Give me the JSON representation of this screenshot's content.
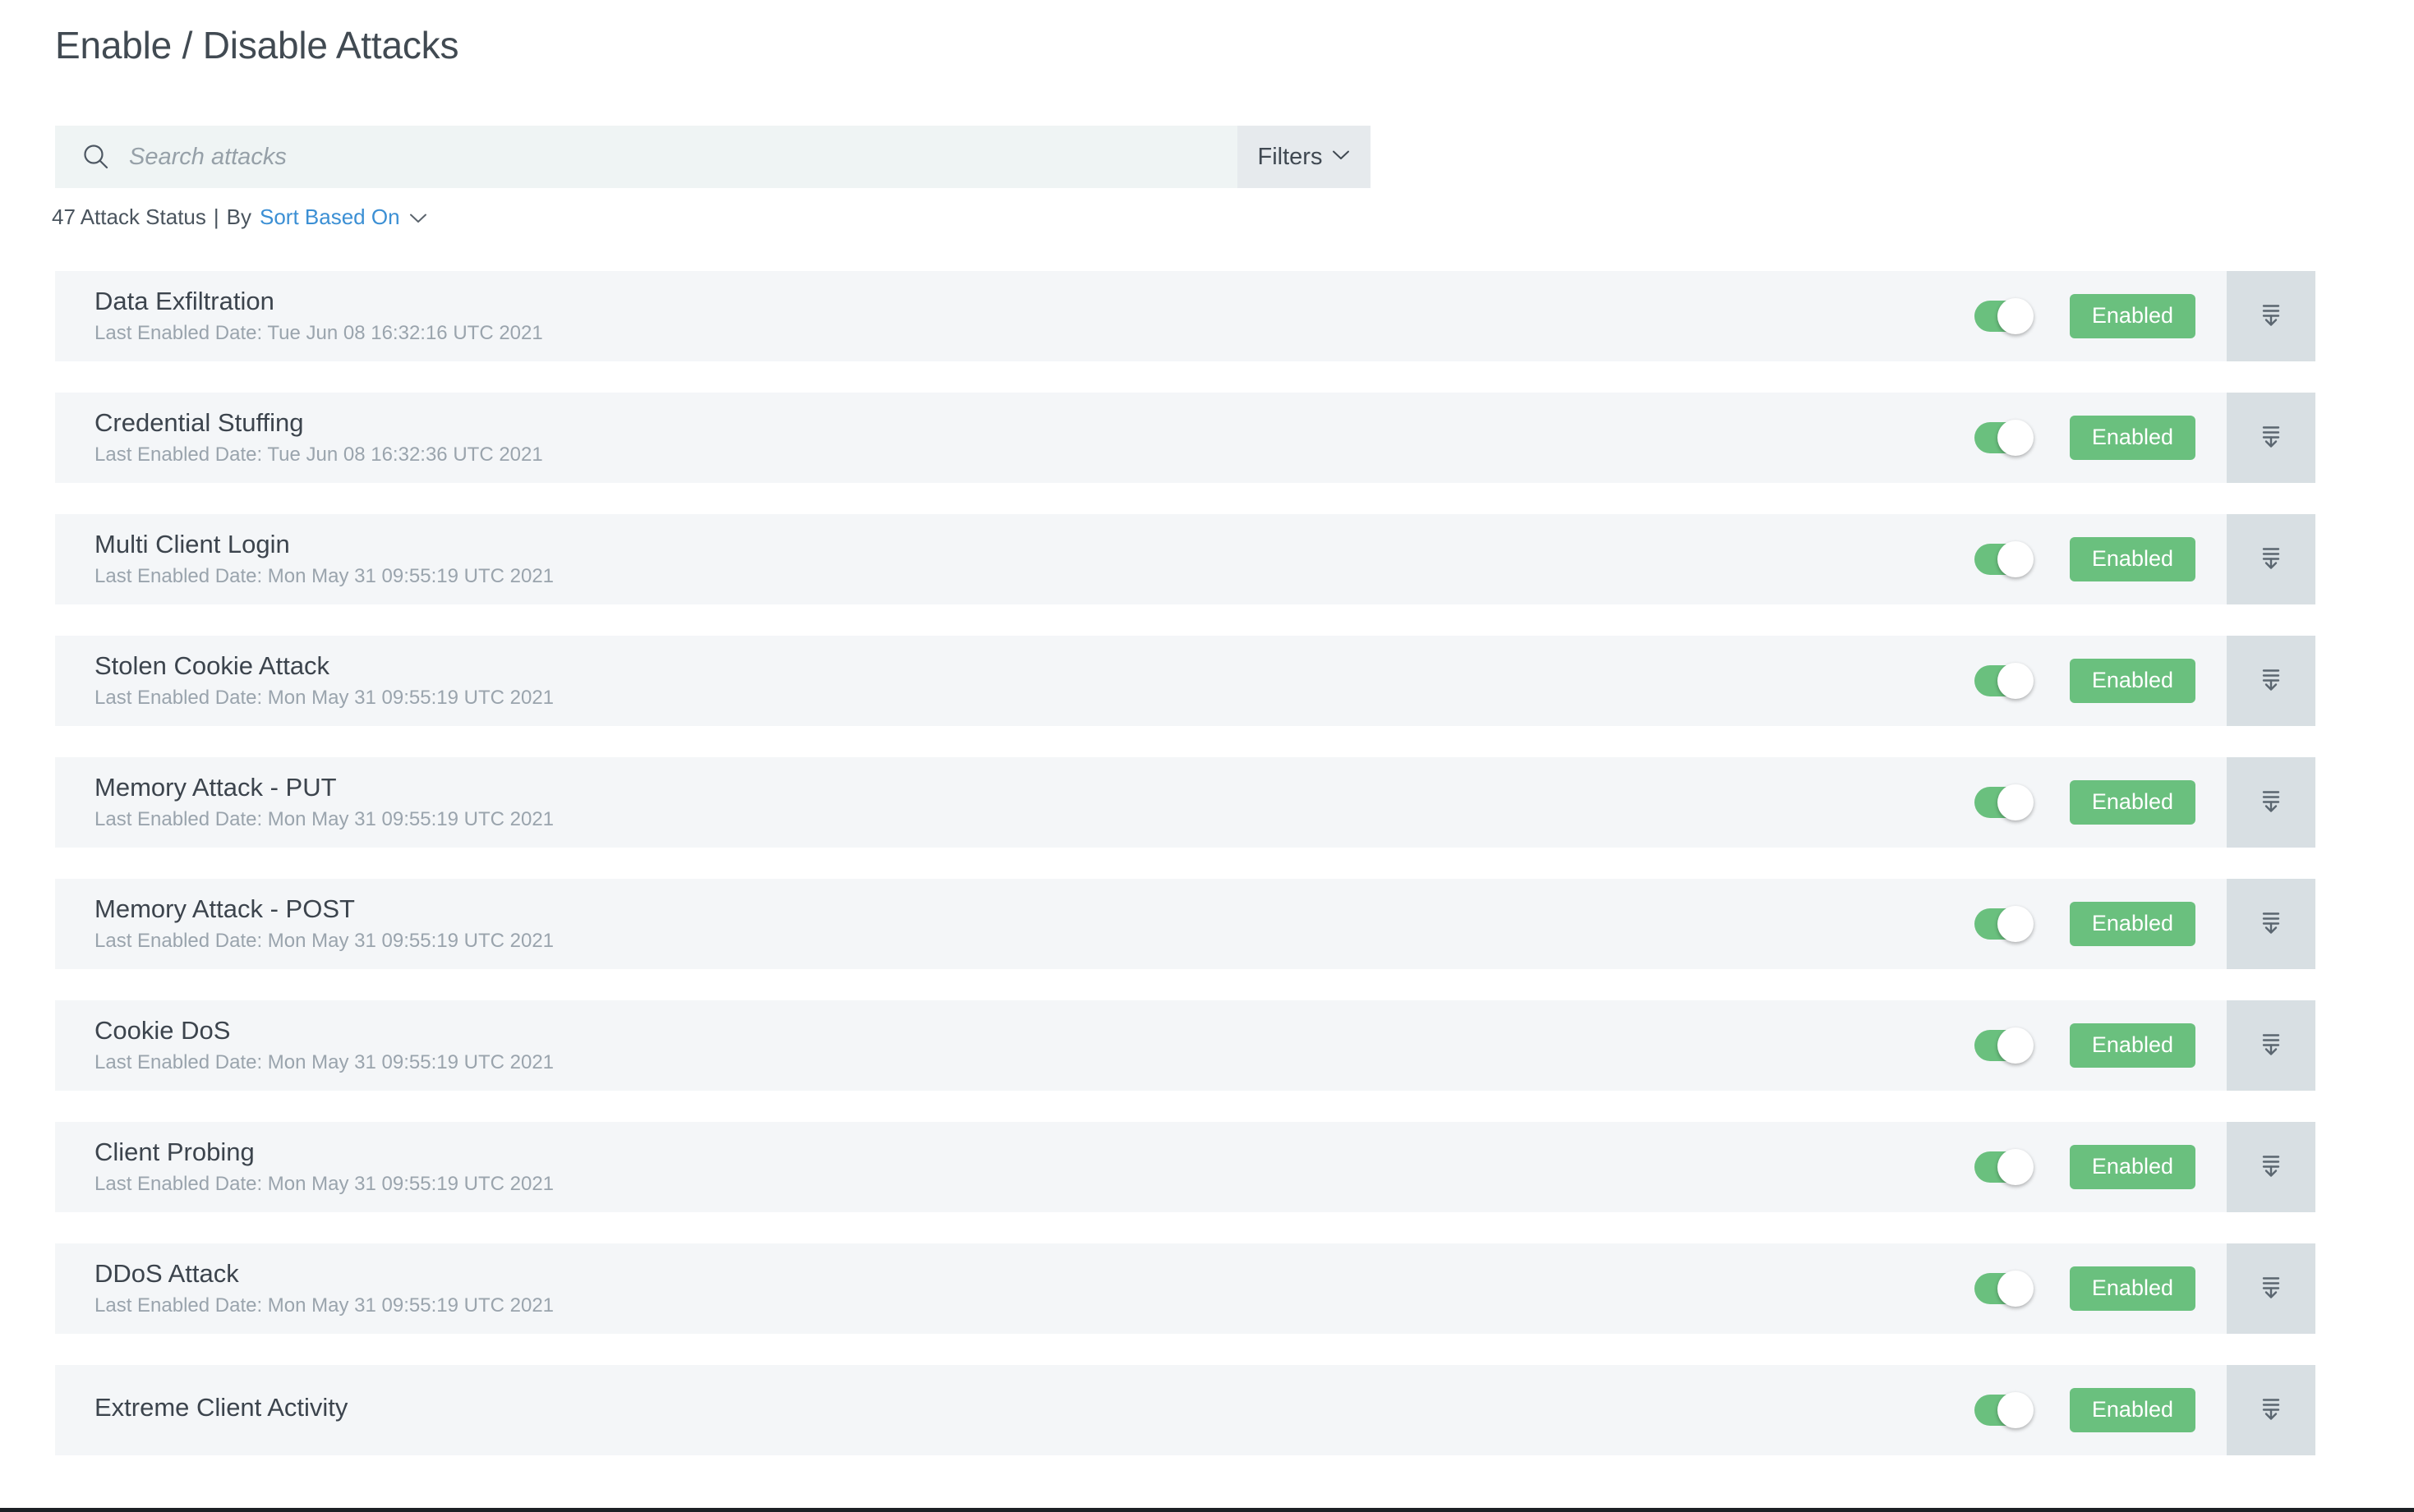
{
  "header": {
    "title": "Enable / Disable Attacks"
  },
  "search": {
    "placeholder": "Search attacks",
    "value": "",
    "icon": "search-icon",
    "filters_label": "Filters",
    "filters_icon": "chevron-down-icon"
  },
  "status_line": {
    "count_text": "47 Attack Status",
    "separator": "|",
    "by_label": "By",
    "sort_link": "Sort Based On",
    "sort_icon": "chevron-down-icon"
  },
  "colors": {
    "accent_green": "#6ac07e",
    "link_blue": "#3b8fd4",
    "row_bg": "#f4f6f8",
    "action_bg": "#d8dfe3",
    "search_bg": "#eff4f4",
    "filters_bg": "#e6eaed",
    "title_text": "#414a52",
    "subtext": "#9aa4ad"
  },
  "row_labels": {
    "last_enabled_prefix": "Last Enabled Date:",
    "action_icon": "collapse-down-icon",
    "toggle_icon": "toggle-switch-on"
  },
  "attacks": [
    {
      "name": "Data Exfiltration",
      "last_enabled": "Last Enabled Date: Tue Jun 08 16:32:16 UTC 2021",
      "status": "Enabled",
      "toggle_on": true
    },
    {
      "name": "Credential Stuffing",
      "last_enabled": "Last Enabled Date: Tue Jun 08 16:32:36 UTC 2021",
      "status": "Enabled",
      "toggle_on": true
    },
    {
      "name": "Multi Client Login",
      "last_enabled": "Last Enabled Date: Mon May 31 09:55:19 UTC 2021",
      "status": "Enabled",
      "toggle_on": true
    },
    {
      "name": "Stolen Cookie Attack",
      "last_enabled": "Last Enabled Date: Mon May 31 09:55:19 UTC 2021",
      "status": "Enabled",
      "toggle_on": true
    },
    {
      "name": "Memory Attack - PUT",
      "last_enabled": "Last Enabled Date: Mon May 31 09:55:19 UTC 2021",
      "status": "Enabled",
      "toggle_on": true
    },
    {
      "name": "Memory Attack - POST",
      "last_enabled": "Last Enabled Date: Mon May 31 09:55:19 UTC 2021",
      "status": "Enabled",
      "toggle_on": true
    },
    {
      "name": "Cookie DoS",
      "last_enabled": "Last Enabled Date: Mon May 31 09:55:19 UTC 2021",
      "status": "Enabled",
      "toggle_on": true
    },
    {
      "name": "Client Probing",
      "last_enabled": "Last Enabled Date: Mon May 31 09:55:19 UTC 2021",
      "status": "Enabled",
      "toggle_on": true
    },
    {
      "name": "DDoS Attack",
      "last_enabled": "Last Enabled Date: Mon May 31 09:55:19 UTC 2021",
      "status": "Enabled",
      "toggle_on": true
    },
    {
      "name": "Extreme Client Activity",
      "last_enabled": "",
      "status": "Enabled",
      "toggle_on": true
    }
  ]
}
